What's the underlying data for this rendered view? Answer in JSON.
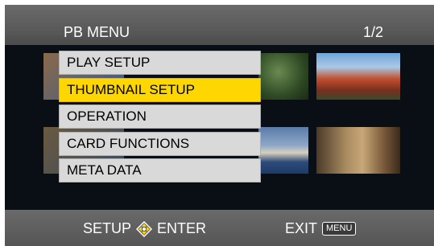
{
  "header": {
    "title": "PB MENU",
    "page": "1/2"
  },
  "menu": {
    "items": [
      {
        "label": "PLAY SETUP",
        "selected": false
      },
      {
        "label": "THUMBNAIL SETUP",
        "selected": true
      },
      {
        "label": "OPERATION",
        "selected": false
      },
      {
        "label": "CARD FUNCTIONS",
        "selected": false
      },
      {
        "label": "META DATA",
        "selected": false
      }
    ]
  },
  "footer": {
    "setup_label": "SETUP",
    "enter_label": "ENTER",
    "exit_label": "EXIT",
    "menu_badge": "MENU",
    "dpad_icon": "dpad-icon"
  },
  "colors": {
    "selected": "#ffd700",
    "item_bg": "#d9d9d9",
    "bar_bg": "#5a5a5a",
    "screen_bg": "#0d1118"
  }
}
